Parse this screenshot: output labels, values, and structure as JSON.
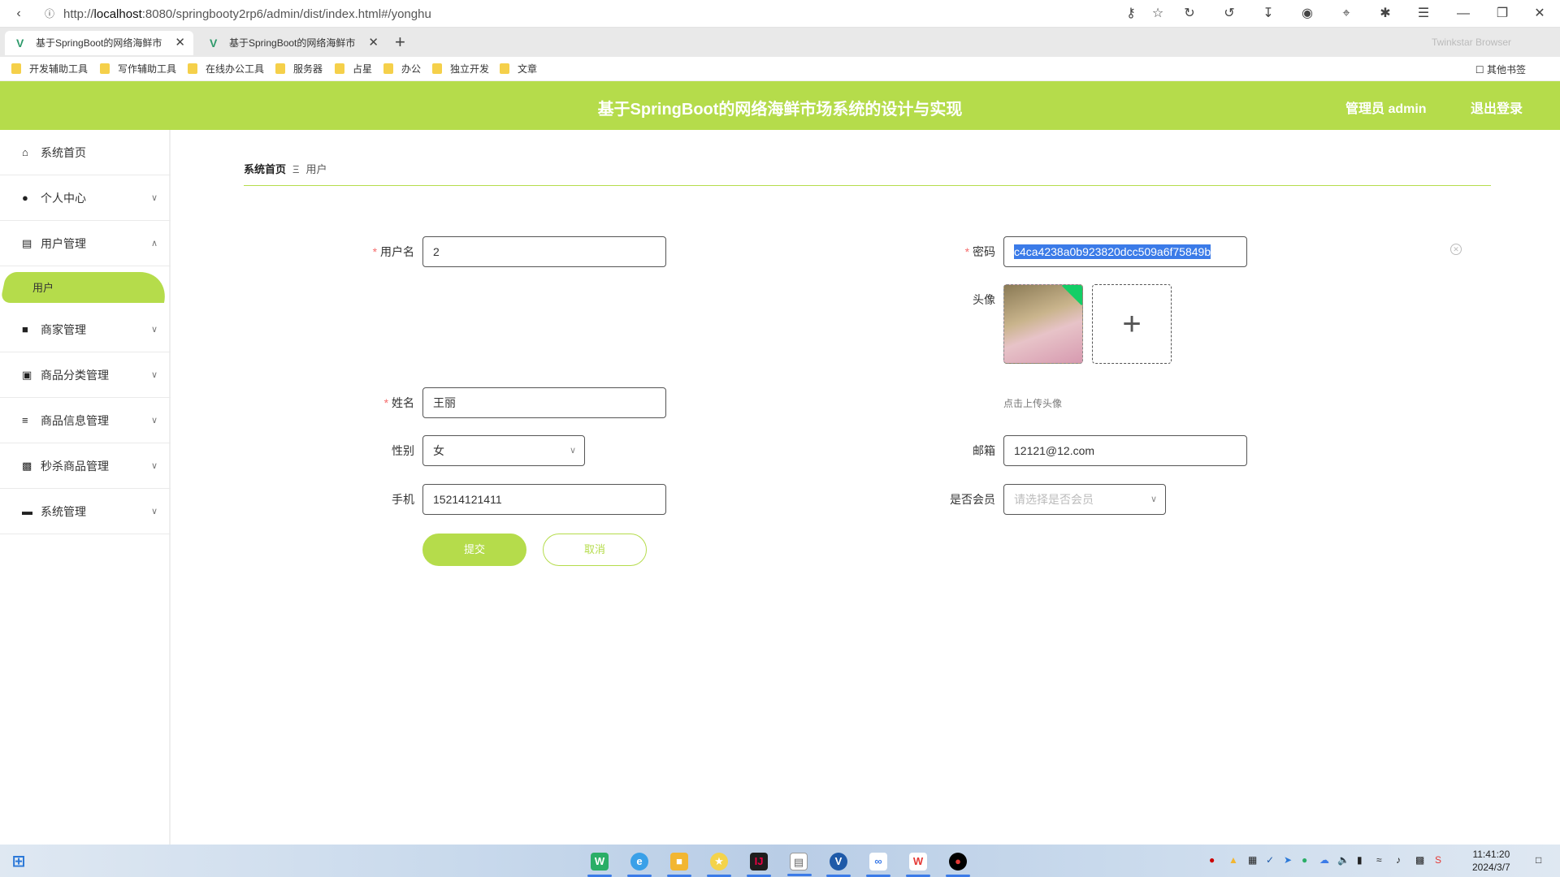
{
  "browser": {
    "url_prefix": "http://",
    "url_host": "localhost",
    "url_rest": ":8080/springbooty2rp6/admin/dist/index.html#/yonghu",
    "tabs": [
      {
        "label": "基于SpringBoot的网络海鲜市"
      },
      {
        "label": "基于SpringBoot的网络海鲜市"
      }
    ],
    "brand": "Twinkstar Browser",
    "bookmarks": [
      "开发辅助工具",
      "写作辅助工具",
      "在线办公工具",
      "服务器",
      "占星",
      "办公",
      "独立开发",
      "文章"
    ],
    "other_bookmarks": "其他书签"
  },
  "header": {
    "title": "基于SpringBoot的网络海鲜市场系统的设计与实现",
    "admin": "管理员 admin",
    "logout": "退出登录"
  },
  "sidebar": {
    "items": [
      {
        "label": "系统首页",
        "icon": "home-icon"
      },
      {
        "label": "个人中心",
        "icon": "user-icon"
      },
      {
        "label": "用户管理",
        "icon": "clipboard-icon"
      },
      {
        "label": "商家管理",
        "icon": "chat-icon"
      },
      {
        "label": "商品分类管理",
        "icon": "box-icon"
      },
      {
        "label": "商品信息管理",
        "icon": "sliders-icon"
      },
      {
        "label": "秒杀商品管理",
        "icon": "wallet-icon"
      },
      {
        "label": "系统管理",
        "icon": "monitor-icon"
      }
    ],
    "active_sub": "用户"
  },
  "breadcrumb": {
    "home": "系统首页",
    "sep": "Ξ",
    "current": "用户"
  },
  "form": {
    "username_label": "用户名",
    "username_value": "2",
    "password_label": "密码",
    "password_value": "c4ca4238a0b923820dcc509a6f75849b",
    "avatar_label": "头像",
    "avatar_tip": "点击上传头像",
    "name_label": "姓名",
    "name_value": "王丽",
    "gender_label": "性别",
    "gender_value": "女",
    "email_label": "邮箱",
    "email_value": "12121@12.com",
    "phone_label": "手机",
    "phone_value": "15214121411",
    "member_label": "是否会员",
    "member_placeholder": "请选择是否会员",
    "submit": "提交",
    "cancel": "取消"
  },
  "taskbar": {
    "time": "11:41:20",
    "date": "2024/3/7"
  },
  "colors": {
    "accent": "#b5dc4b",
    "required": "#f56c6c",
    "selection": "#3b7be8"
  }
}
